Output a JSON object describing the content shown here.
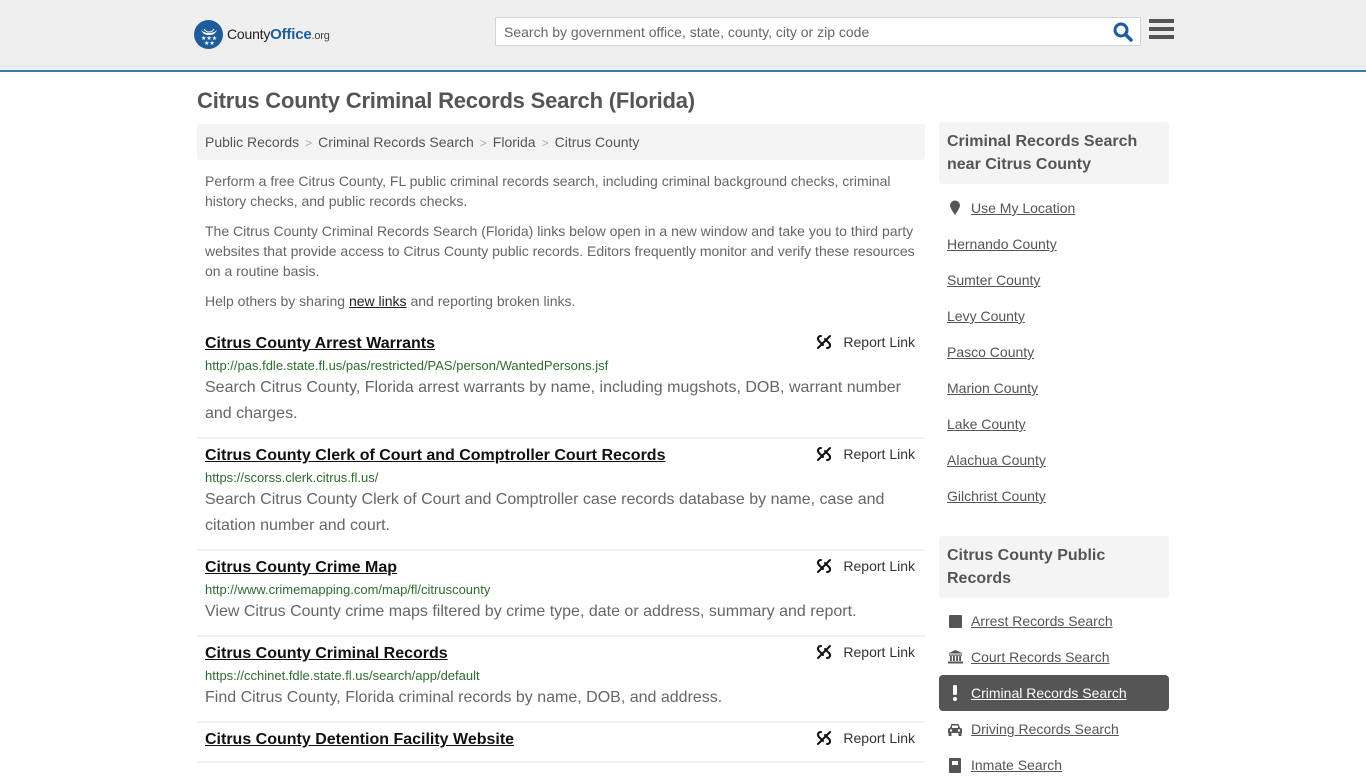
{
  "header": {
    "logo": {
      "part1": "County",
      "part2": "Office",
      "part3": ".org"
    },
    "search_placeholder": "Search by government office, state, county, city or zip code",
    "search_value": "",
    "accent_color": "#1f5c9a"
  },
  "page_title": "Citrus County Criminal Records Search (Florida)",
  "breadcrumb": [
    "Public Records",
    "Criminal Records Search",
    "Florida",
    "Citrus County"
  ],
  "intro": {
    "p1": "Perform a free Citrus County, FL public criminal records search, including criminal background checks, criminal history checks, and public records checks.",
    "p2": "The Citrus County Criminal Records Search (Florida) links below open in a new window and take you to third party websites that provide access to Citrus County public records. Editors frequently monitor and verify these resources on a routine basis.",
    "p3_before": "Help others by sharing ",
    "p3_link": "new links",
    "p3_after": " and reporting broken links."
  },
  "report_label": "Report Link",
  "results": [
    {
      "title": "Citrus County Arrest Warrants",
      "url": "http://pas.fdle.state.fl.us/pas/restricted/PAS/person/WantedPersons.jsf",
      "desc": "Search Citrus County, Florida arrest warrants by name, including mugshots, DOB, warrant number and charges."
    },
    {
      "title": "Citrus County Clerk of Court and Comptroller Court Records",
      "url": "https://scorss.clerk.citrus.fl.us/",
      "desc": "Search Citrus County Clerk of Court and Comptroller case records database by name, case and citation number and court."
    },
    {
      "title": "Citrus County Crime Map",
      "url": "http://www.crimemapping.com/map/fl/citruscounty",
      "desc": "View Citrus County crime maps filtered by crime type, date or address, summary and report."
    },
    {
      "title": "Citrus County Criminal Records",
      "url": "https://cchinet.fdle.state.fl.us/search/app/default",
      "desc": "Find Citrus County, Florida criminal records by name, DOB, and address."
    },
    {
      "title": "Citrus County Detention Facility Website",
      "url": "",
      "desc": ""
    }
  ],
  "sidebar": {
    "nearby_title": "Criminal Records Search near Citrus County",
    "use_location": "Use My Location",
    "nearby": [
      "Hernando County",
      "Sumter County",
      "Levy County",
      "Pasco County",
      "Marion County",
      "Lake County",
      "Alachua County",
      "Gilchrist County"
    ],
    "public_title": "Citrus County Public Records",
    "public_links": [
      {
        "label": "Arrest Records Search",
        "icon": "square-icon",
        "active": false
      },
      {
        "label": "Court Records Search",
        "icon": "courthouse-icon",
        "active": false
      },
      {
        "label": "Criminal Records Search",
        "icon": "exclamation-icon",
        "active": true
      },
      {
        "label": "Driving Records Search",
        "icon": "car-icon",
        "active": false
      },
      {
        "label": "Inmate Search",
        "icon": "inmate-icon",
        "active": false
      }
    ]
  }
}
